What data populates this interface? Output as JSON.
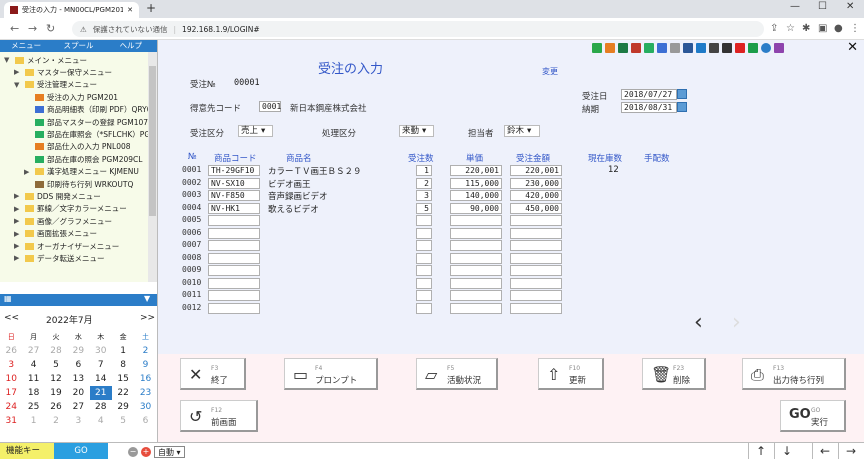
{
  "browser": {
    "tab_title": "受注の入力 - MN00CL/PGM201/...",
    "security_text": "保護されていない通信",
    "url": "192.168.1.9/LOGIN#"
  },
  "left_tabs": [
    "メニュー",
    "スプール",
    "ヘルプ"
  ],
  "tree": [
    {
      "label": "メイン・メニュー",
      "indent": 0,
      "icon": "folder",
      "arrow": "▼"
    },
    {
      "label": "マスター保守メニュー",
      "indent": 1,
      "icon": "folder",
      "arrow": "▶"
    },
    {
      "label": "受注管理メニュー",
      "indent": 1,
      "icon": "folder",
      "arrow": "▼"
    },
    {
      "label": "受注の入力 PGM201",
      "indent": 2,
      "icon": "down",
      "arrow": ""
    },
    {
      "label": "商品明細表（印刷 PDF）QRY00",
      "indent": 2,
      "icon": "doc",
      "arrow": ""
    },
    {
      "label": "部品マスターの登録 PGM107",
      "indent": 2,
      "icon": "green",
      "arrow": ""
    },
    {
      "label": "部品在庫照会（*SFLCHK）PGM",
      "indent": 2,
      "icon": "green",
      "arrow": ""
    },
    {
      "label": "部品仕入の入力 PNL008",
      "indent": 2,
      "icon": "down",
      "arrow": ""
    },
    {
      "label": "部品在庫の照会 PGM209CL",
      "indent": 2,
      "icon": "green",
      "arrow": ""
    },
    {
      "label": "漢字処理メニュー KJMENU",
      "indent": 2,
      "icon": "folder",
      "arrow": "▶"
    },
    {
      "label": "印刷待ち行列 WRKOUTQ",
      "indent": 2,
      "icon": "printer",
      "arrow": ""
    },
    {
      "label": "DDS 開発メニュー",
      "indent": 1,
      "icon": "folder",
      "arrow": "▶"
    },
    {
      "label": "罫線／文字カラーメニュー",
      "indent": 1,
      "icon": "folder",
      "arrow": "▶"
    },
    {
      "label": "画像／グラフメニュー",
      "indent": 1,
      "icon": "folder",
      "arrow": "▶"
    },
    {
      "label": "画面拡張メニュー",
      "indent": 1,
      "icon": "folder",
      "arrow": "▶"
    },
    {
      "label": "オーガナイザーメニュー",
      "indent": 1,
      "icon": "folder",
      "arrow": "▶"
    },
    {
      "label": "データ転送メニュー",
      "indent": 1,
      "icon": "folder",
      "arrow": "▶"
    }
  ],
  "calendar": {
    "month_label": "2022年7月",
    "prev": "<<",
    "next": ">>",
    "weekdays": [
      "日",
      "月",
      "火",
      "水",
      "木",
      "金",
      "土"
    ],
    "weeks": [
      [
        "26",
        "27",
        "28",
        "29",
        "30",
        "1",
        "2"
      ],
      [
        "3",
        "4",
        "5",
        "6",
        "7",
        "8",
        "9"
      ],
      [
        "10",
        "11",
        "12",
        "13",
        "14",
        "15",
        "16"
      ],
      [
        "17",
        "18",
        "19",
        "20",
        "21",
        "22",
        "23"
      ],
      [
        "24",
        "25",
        "26",
        "27",
        "28",
        "29",
        "30"
      ],
      [
        "31",
        "1",
        "2",
        "3",
        "4",
        "5",
        "6"
      ]
    ],
    "today": "21"
  },
  "form": {
    "title": "受注の入力",
    "change_link": "変更",
    "order_no_label": "受注№",
    "order_no": "00001",
    "customer_label": "得意先コード",
    "customer_code": "0001",
    "customer_name": "新日本鋼産株式会社",
    "order_date_label": "受注日",
    "order_date": "2018/07/27",
    "due_date_label": "納期",
    "due_date": "2018/08/31",
    "kubun_label": "受注区分",
    "kubun": "売上",
    "shori_label": "処理区分",
    "shori": "来勤",
    "tanto_label": "担当者",
    "tanto": "鈴木",
    "columns": [
      "№",
      "商品コード",
      "商品名",
      "受注数",
      "単価",
      "受注金額",
      "現在庫数",
      "手配数"
    ],
    "rows": [
      {
        "no": "0001",
        "code": "TH-29GF10",
        "name": "カラーＴＶ画王ＢＳ２９",
        "qty": "1",
        "price": "220,001",
        "amount": "220,001",
        "stock": "12"
      },
      {
        "no": "0002",
        "code": "NV-SX10",
        "name": "ビデオ画王",
        "qty": "2",
        "price": "115,000",
        "amount": "230,000",
        "stock": ""
      },
      {
        "no": "0003",
        "code": "NV-F850",
        "name": "音声録画ビデオ",
        "qty": "3",
        "price": "140,000",
        "amount": "420,000",
        "stock": ""
      },
      {
        "no": "0004",
        "code": "NV-HK1",
        "name": "歌えるビデオ",
        "qty": "5",
        "price": "90,000",
        "amount": "450,000",
        "stock": ""
      },
      {
        "no": "0005",
        "code": "",
        "name": "",
        "qty": "",
        "price": "",
        "amount": "",
        "stock": ""
      },
      {
        "no": "0006",
        "code": "",
        "name": "",
        "qty": "",
        "price": "",
        "amount": "",
        "stock": ""
      },
      {
        "no": "0007",
        "code": "",
        "name": "",
        "qty": "",
        "price": "",
        "amount": "",
        "stock": ""
      },
      {
        "no": "0008",
        "code": "",
        "name": "",
        "qty": "",
        "price": "",
        "amount": "",
        "stock": ""
      },
      {
        "no": "0009",
        "code": "",
        "name": "",
        "qty": "",
        "price": "",
        "amount": "",
        "stock": ""
      },
      {
        "no": "0010",
        "code": "",
        "name": "",
        "qty": "",
        "price": "",
        "amount": "",
        "stock": ""
      },
      {
        "no": "0011",
        "code": "",
        "name": "",
        "qty": "",
        "price": "",
        "amount": "",
        "stock": ""
      },
      {
        "no": "0012",
        "code": "",
        "name": "",
        "qty": "",
        "price": "",
        "amount": "",
        "stock": ""
      }
    ]
  },
  "fkeys": [
    {
      "key": "F3",
      "label": "終了",
      "icon": "✕",
      "name": "f3-exit-button"
    },
    {
      "key": "F4",
      "label": "プロンプト",
      "icon": "▭",
      "name": "f4-prompt-button"
    },
    {
      "key": "F5",
      "label": "活動状況",
      "icon": "▱",
      "name": "f5-activity-button"
    },
    {
      "key": "F10",
      "label": "更新",
      "icon": "⇧",
      "name": "f10-update-button"
    },
    {
      "key": "F23",
      "label": "削除",
      "icon": "🗑",
      "name": "f23-delete-button"
    },
    {
      "key": "F13",
      "label": "出力待ち行列",
      "icon": "⎙",
      "name": "f13-outq-button"
    },
    {
      "key": "F12",
      "label": "前画面",
      "icon": "↺",
      "name": "f12-back-button"
    },
    {
      "key": "GO",
      "label": "実行",
      "icon": "GO",
      "name": "go-execute-button"
    }
  ],
  "status": {
    "func_key_label": "機能キー",
    "go_label": "GO",
    "zoom": "自動"
  },
  "colors": {
    "accent": "#2b7dc8",
    "title": "#3357c8",
    "form_bg": "#eef1fb",
    "fkey_bg": "#fef2f4"
  }
}
